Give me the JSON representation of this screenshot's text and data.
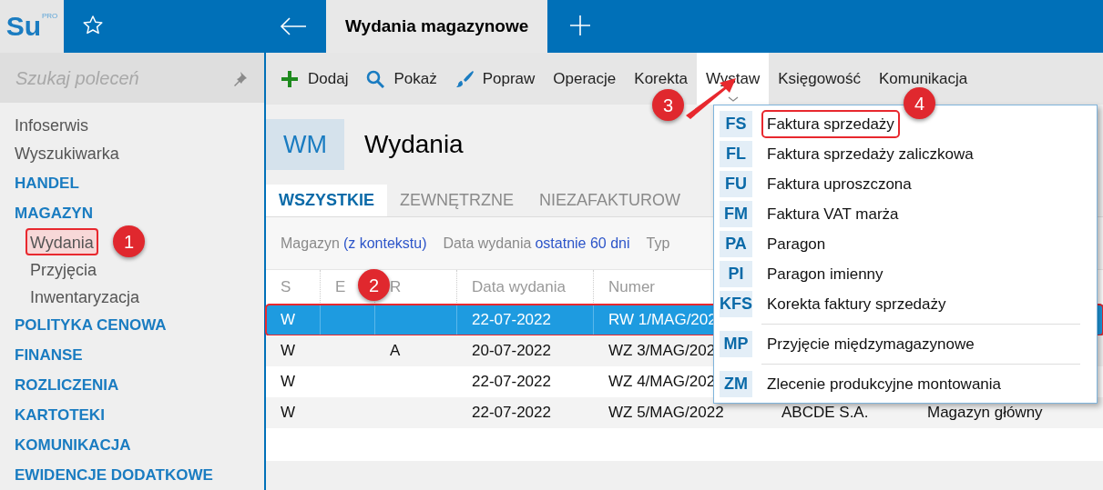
{
  "app": {
    "logo": "Su",
    "logo_edition": "PRO"
  },
  "tabs": [
    {
      "label": "Wydania magazynowe",
      "selected": true
    }
  ],
  "sidebar": {
    "search": {
      "placeholder": "Szukaj poleceń"
    },
    "items": [
      {
        "kind": "link",
        "label": "Infoserwis"
      },
      {
        "kind": "link",
        "label": "Wyszukiwarka"
      },
      {
        "kind": "section",
        "label": "HANDEL"
      },
      {
        "kind": "section",
        "label": "MAGAZYN",
        "children": [
          {
            "label": "Wydania",
            "highlighted": true
          },
          {
            "label": "Przyjęcia",
            "highlighted": false
          },
          {
            "label": "Inwentaryzacja",
            "highlighted": false
          }
        ]
      },
      {
        "kind": "section",
        "label": "POLITYKA CENOWA"
      },
      {
        "kind": "section",
        "label": "FINANSE"
      },
      {
        "kind": "section",
        "label": "ROZLICZENIA"
      },
      {
        "kind": "section",
        "label": "KARTOTEKI"
      },
      {
        "kind": "section",
        "label": "KOMUNIKACJA"
      },
      {
        "kind": "section",
        "label": "EWIDENCJE DODATKOWE"
      }
    ]
  },
  "toolbar": [
    {
      "label": "Dodaj",
      "expanded": false
    },
    {
      "label": "Pokaż",
      "expanded": false
    },
    {
      "label": "Popraw",
      "expanded": false
    },
    {
      "label": "Operacje",
      "expanded": false
    },
    {
      "label": "Korekta",
      "expanded": false
    },
    {
      "label": "Wystaw",
      "expanded": true
    },
    {
      "label": "Księgowość",
      "expanded": false
    },
    {
      "label": "Komunikacja",
      "expanded": false
    }
  ],
  "header": {
    "code": "WM",
    "title": "Wydania"
  },
  "view_tabs": [
    {
      "label": "WSZYSTKIE",
      "selected": true
    },
    {
      "label": "ZEWNĘTRZNE",
      "selected": false
    },
    {
      "label": "NIEZAFAKTUROW",
      "selected": false
    }
  ],
  "filters": [
    {
      "label": "Magazyn",
      "value": "(z kontekstu)"
    },
    {
      "label": "Data wydania",
      "value": "ostatnie 60 dni"
    },
    {
      "label": "Typ"
    }
  ],
  "table": {
    "columns": [
      "S",
      "E",
      "R",
      "Data wydania",
      "Numer"
    ],
    "rows": [
      {
        "selected": true,
        "highlighted": true,
        "s": "W",
        "date": "22-07-2022",
        "number": "RW 1/MAG/202"
      },
      {
        "selected": false,
        "highlighted": false,
        "s": "W",
        "r": "A",
        "date": "20-07-2022",
        "number": "WZ 3/MAG/202"
      },
      {
        "selected": false,
        "highlighted": false,
        "s": "W",
        "date": "22-07-2022",
        "number": "WZ 4/MAG/202"
      },
      {
        "selected": false,
        "highlighted": false,
        "s": "W",
        "date": "22-07-2022",
        "number": "WZ 5/MAG/2022",
        "column_6": "ABCDE S.A.",
        "column_7": "Magazyn główny"
      }
    ]
  },
  "dropdown": {
    "items": [
      {
        "code": "FS",
        "label": "Faktura sprzedaży",
        "highlighted": true
      },
      {
        "code": "FL",
        "label": "Faktura sprzedaży zaliczkowa",
        "highlighted": false
      },
      {
        "code": "FU",
        "label": "Faktura uproszczona",
        "highlighted": false
      },
      {
        "code": "FM",
        "label": "Faktura VAT marża",
        "highlighted": false
      },
      {
        "code": "PA",
        "label": "Paragon",
        "highlighted": false
      },
      {
        "code": "PI",
        "label": "Paragon imienny",
        "highlighted": false
      },
      {
        "code": "KFS",
        "label": "Korekta faktury sprzedaży",
        "highlighted": false,
        "separator_after": true
      },
      {
        "code": "MP",
        "label": "Przyjęcie międzymagazynowe",
        "highlighted": false,
        "separator_after": true
      },
      {
        "code": "ZM",
        "label": "Zlecenie produkcyjne montowania",
        "highlighted": false
      }
    ]
  },
  "annotations": [
    {
      "label": "1"
    },
    {
      "label": "2"
    },
    {
      "label": "3"
    },
    {
      "label": "4"
    }
  ]
}
